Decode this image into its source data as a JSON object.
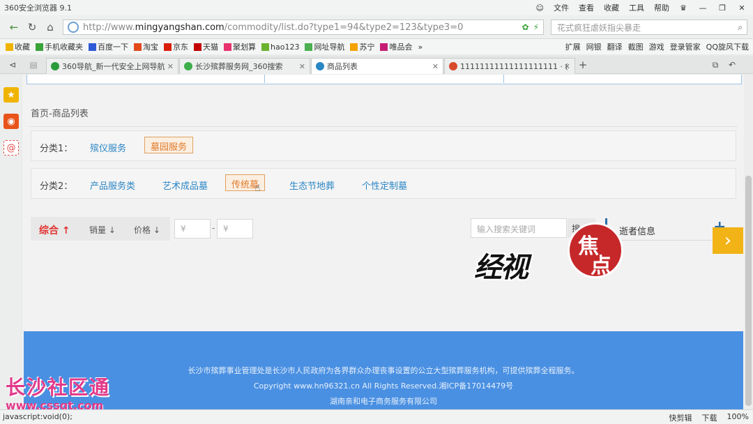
{
  "window": {
    "title": "360安全浏览器 9.1",
    "menu": [
      "文件",
      "查看",
      "收藏",
      "工具",
      "帮助"
    ]
  },
  "address_bar": {
    "url_prefix": "http://www.",
    "url_domain": "mingyangshan.com",
    "url_path": "/commodity/list.do?type1=94&type2=123&type3=0",
    "search_text": "花式疯狂虐妖指尖暴走"
  },
  "bookmarks": {
    "left": [
      "收藏",
      "手机收藏夹",
      "百度一下",
      "淘宝",
      "京东",
      "天猫",
      "聚划算",
      "hao123",
      "网址导航",
      "苏宁",
      "唯品会"
    ],
    "right": [
      "扩展",
      "网银",
      "翻译",
      "截图",
      "游戏",
      "登录管家",
      "QQ旋风下载"
    ]
  },
  "tabs": [
    {
      "label": "360导航_新一代安全上网导航",
      "color": "#2a9b3a"
    },
    {
      "label": "长沙殡葬服务网_360搜索",
      "color": "#3cae4a"
    },
    {
      "label": "商品列表",
      "color": "#2b86c5"
    },
    {
      "label": "11111111111111111111 · (",
      "color": "#d94a2a"
    }
  ],
  "page": {
    "breadcrumb": "首页-商品列表",
    "category1": {
      "label": "分类1：",
      "options": [
        "殡仪服务",
        "墓园服务"
      ],
      "selected": "墓园服务"
    },
    "category2": {
      "label": "分类2：",
      "options": [
        "产品服务类",
        "艺术成品墓",
        "传统墓",
        "生态节地葬",
        "个性定制墓"
      ],
      "selected": "传统墓"
    },
    "sort": {
      "overall": "综合 ↑",
      "sales": "销量 ↓",
      "price": "价格 ↓",
      "price_min_placeholder": "¥",
      "price_max_placeholder": "¥",
      "dash": "-"
    },
    "search": {
      "placeholder": "输入搜索关键词",
      "button": "搜"
    },
    "side_panel": {
      "title": "逝者信息",
      "plus": "+"
    },
    "next_arrow": "›",
    "footer": {
      "line1": "长沙市殡葬事业管理处是长沙市人民政府为各界群众办理丧事设置的公立大型殡葬服务机构，可提供殡葬全程服务。",
      "line2": "Copyright www.hn96321.cn All Rights Reserved.湘ICP备17014479号",
      "line3": "湖南亲和电子商务服务有限公司"
    }
  },
  "watermarks": {
    "logo_black": "经视",
    "logo_circle_1": "焦",
    "logo_circle_2": "点",
    "corner_big": "长沙社区通",
    "corner_small": "www.cssqt.com"
  },
  "status_bar": {
    "left": "javascript:void(0);",
    "right": [
      "快剪辑",
      "下载",
      "100%"
    ]
  }
}
